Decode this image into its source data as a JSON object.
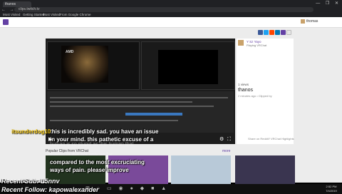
{
  "browser": {
    "tab_title": "thanos",
    "url": "clips.twitch.tv",
    "bookmarks": [
      "Most Visited",
      "Getting Started",
      "Most Visited",
      "From Google Chrome"
    ],
    "window_controls": "— ❐ ✕",
    "nav_icons": "← → ⟳"
  },
  "header": {
    "user_name": "thomas"
  },
  "video": {
    "logo_text": "AMD",
    "caption_line1": "this is incredibly sad. you have an issue",
    "caption_line2": "in your mind. this pathetic excuse of a",
    "caption_ghost1": "human is so stupid as this human that",
    "caption_ghost2": "thanos in this not only up for",
    "controls": {
      "play": "▶",
      "settings": "⚙",
      "fullscreen": "⛶"
    }
  },
  "chat": {
    "username": "itsunderdog10"
  },
  "clip": {
    "streamer_name": "Y Sz Yayo",
    "streamer_game": "Playing VRChat",
    "views": "1 views",
    "title": "thanos",
    "meta": "2 minutes ago • Clipped by",
    "actions": [
      "Share on Reddit?",
      "VRChat Highlights"
    ]
  },
  "popular": {
    "title": "Popular Clips from VRChat",
    "link": "more",
    "caption_line1": "compared to the most excruciating",
    "caption_line2": "ways of pain. please improve"
  },
  "overlay": {
    "recent_sub": "Recent Sub: L5nnv",
    "recent_follow": "Recent Follow: kapowalexander"
  },
  "taskbar": {
    "icons": "⊞ ○ ▭ ◉ ● ◆ ■ ▲",
    "clock_time": "2:52 PM",
    "clock_date": "7/4/2019"
  },
  "colors": {
    "brand": "#6441a4",
    "chat_username": "#f1c40f",
    "share": [
      "#3b5998",
      "#1da1f2",
      "#ff4500",
      "#0077b5",
      "#6441a4",
      "#e6e6e6"
    ]
  }
}
